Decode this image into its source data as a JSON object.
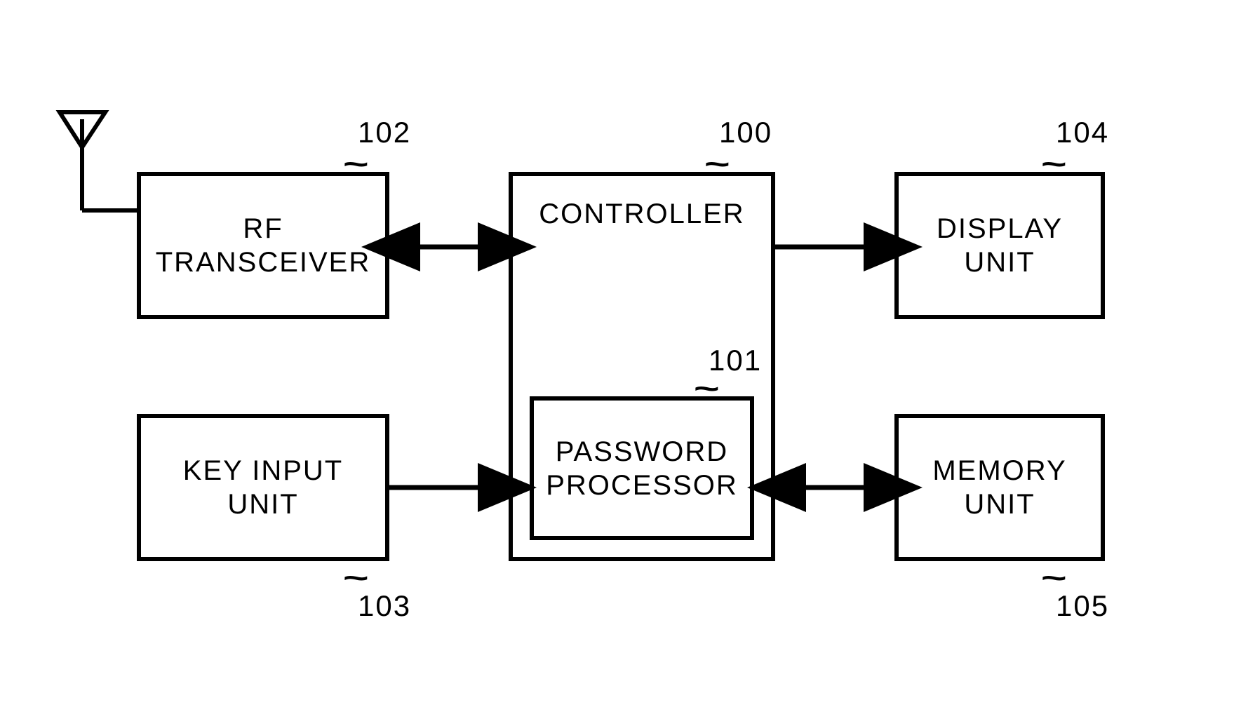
{
  "blocks": {
    "rf": {
      "line1": "RF",
      "line2": "TRANSCEIVER",
      "ref": "102"
    },
    "key": {
      "line1": "KEY INPUT",
      "line2": "UNIT",
      "ref": "103"
    },
    "controller": {
      "title": "CONTROLLER",
      "ref": "100"
    },
    "password": {
      "line1": "PASSWORD",
      "line2": "PROCESSOR",
      "ref": "101"
    },
    "display": {
      "line1": "DISPLAY",
      "line2": "UNIT",
      "ref": "104"
    },
    "memory": {
      "line1": "MEMORY",
      "line2": "UNIT",
      "ref": "105"
    }
  }
}
